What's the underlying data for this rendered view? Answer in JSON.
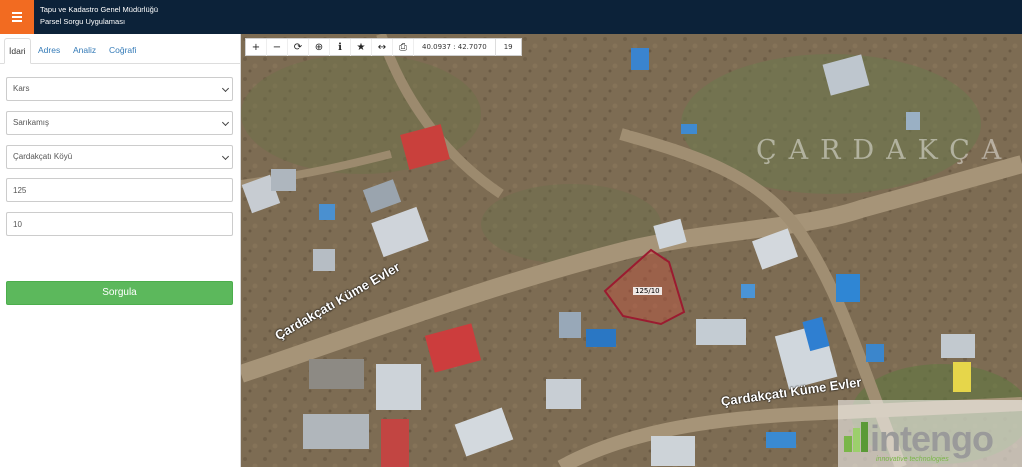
{
  "header": {
    "title_line1": "Tapu ve Kadastro Genel Müdürlüğü",
    "title_line2": "Parsel Sorgu Uygulaması",
    "accent": "#f26b21",
    "bg": "#0c2239"
  },
  "sidebar": {
    "tabs": [
      {
        "label": "İdari"
      },
      {
        "label": "Adres"
      },
      {
        "label": "Analiz"
      },
      {
        "label": "Coğrafi"
      }
    ],
    "fields": {
      "province": "Kars",
      "district": "Sarıkamış",
      "neighborhood": "Çardakçatı Köyü",
      "block": "125",
      "parcel": "10"
    },
    "submit_label": "Sorgula",
    "submit_color": "#5cb85c"
  },
  "map": {
    "toolbar": {
      "icons": [
        "zoom-in-icon",
        "zoom-out-icon",
        "refresh-icon",
        "locate-icon",
        "info-icon",
        "star-icon",
        "measure-icon",
        "print-icon"
      ],
      "coordinates": "40.0937 : 42.7070",
      "zoom": "19"
    },
    "village_label": "ÇARDAKÇA",
    "road_label_1": "Çardakçatı Küme Evler",
    "road_label_2": "Çardakçatı Küme Evler",
    "parcel_label": "125/10",
    "parcel_color": "#9b1b30",
    "watermark": {
      "brand": "intengo",
      "tagline": "innovative technologies"
    }
  }
}
